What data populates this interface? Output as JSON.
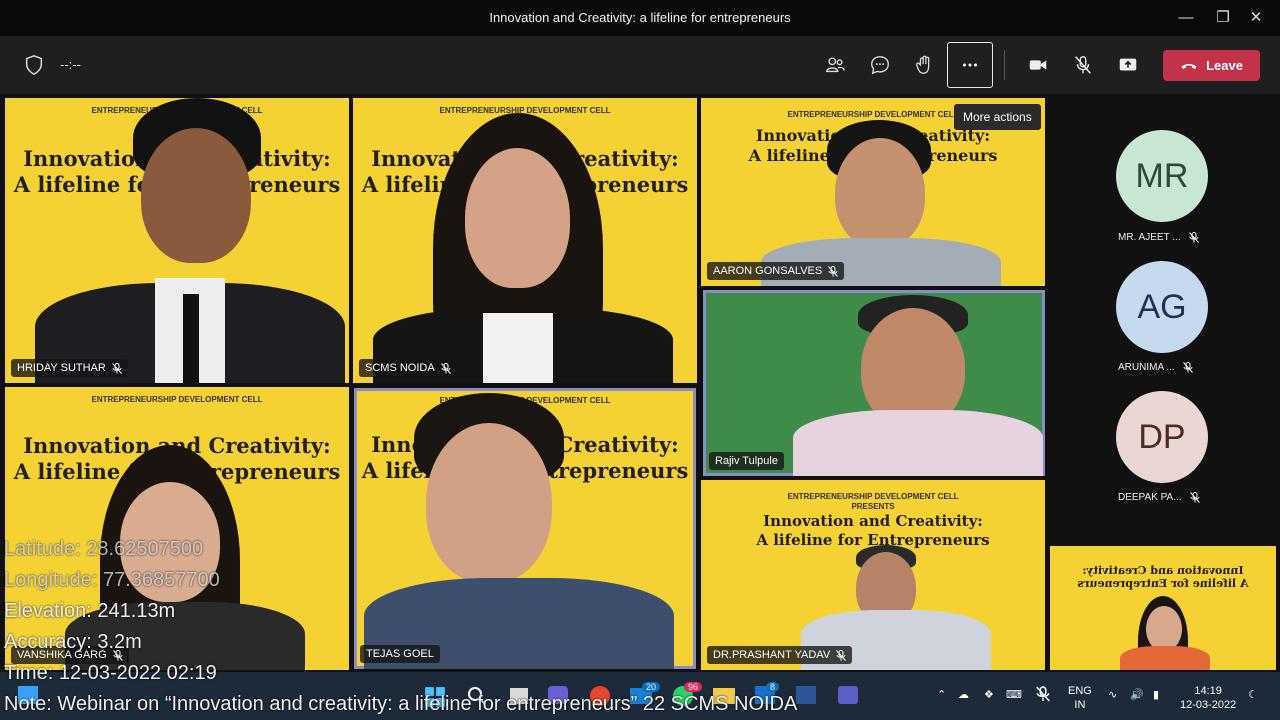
{
  "window": {
    "title": "Innovation and Creativity: a lifeline for entrepreneurs"
  },
  "toolbar": {
    "timer": "--:--",
    "leave_label": "Leave",
    "tooltip": "More actions"
  },
  "banner": {
    "edc": "ENTREPRENEURSHIP DEVELOPMENT CELL",
    "presents": "PRESENTS",
    "line1": "Innovation and Creativity:",
    "line2": "A lifeline for Entrepreneurs"
  },
  "participants": [
    {
      "name": "HRIDAY SUTHAR"
    },
    {
      "name": "SCMS NOIDA"
    },
    {
      "name": "AARON GONSALVES"
    },
    {
      "name": "Rajiv Tulpule"
    },
    {
      "name": "VANSHIKA GARG"
    },
    {
      "name": "TEJAS GOEL"
    },
    {
      "name": "DR.PRASHANT YADAV"
    }
  ],
  "side": [
    {
      "initials": "MR",
      "name": "MR. AJEET ...",
      "color": "#c9e6d3",
      "fg": "#2b4a38"
    },
    {
      "initials": "AG",
      "name": "ARUNIMA ...",
      "color": "#c6d9ee",
      "fg": "#1e3350"
    },
    {
      "initials": "DP",
      "name": "DEEPAK PA...",
      "color": "#ead7d4",
      "fg": "#4a2b28"
    }
  ],
  "overlay": {
    "latitude": "Latitude: 28.62507500",
    "longitude": "Longitude: 77.36857700",
    "elevation": "Elevation: 241.13m",
    "accuracy": "Accuracy: 3.2m",
    "time": "Time: 12-03-2022  02:19",
    "note": "Note: Webinar on “Innovation and creativity: a lifeline for entrepreneurs” 22 SCMS NOIDA"
  },
  "taskbar": {
    "badge_mail": "20",
    "badge_whatsapp": "96",
    "badge_teams": "8",
    "lang1": "ENG",
    "lang2": "IN",
    "time": "14:19",
    "date": "12-03-2022"
  }
}
